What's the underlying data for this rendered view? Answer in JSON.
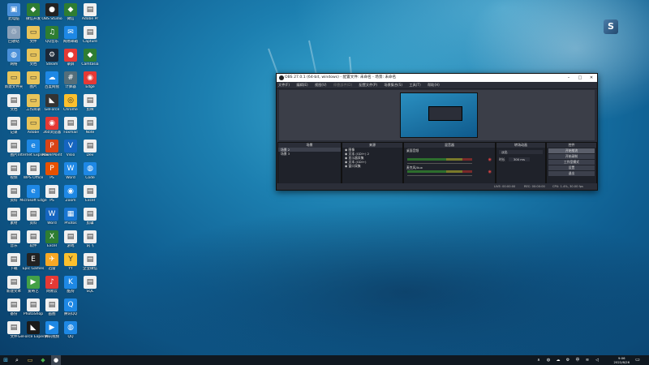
{
  "desktop": {
    "icons": [
      {
        "label": "此电脑",
        "color": "#4a90d9",
        "glyph": "▣"
      },
      {
        "label": "回收站",
        "color": "#8aa0b8",
        "glyph": "♲"
      },
      {
        "label": "网络",
        "color": "#4a90d9",
        "glyph": "◍"
      },
      {
        "label": "新建文件夹",
        "color": "#e8c45a",
        "glyph": "▭"
      },
      {
        "label": "文档",
        "color": "#f0f0f0",
        "glyph": "▤"
      },
      {
        "label": "记录",
        "color": "#f0f0f0",
        "glyph": "▤"
      },
      {
        "label": "图片",
        "color": "#f0f0f0",
        "glyph": "▤"
      },
      {
        "label": "视频",
        "color": "#f0f0f0",
        "glyph": "▤"
      },
      {
        "label": "资料",
        "color": "#f0f0f0",
        "glyph": "▤"
      },
      {
        "label": "素材",
        "color": "#f0f0f0",
        "glyph": "▤"
      },
      {
        "label": "音乐",
        "color": "#f0f0f0",
        "glyph": "▤"
      },
      {
        "label": "下载",
        "color": "#f0f0f0",
        "glyph": "▤"
      },
      {
        "label": "新建文本",
        "color": "#f0f0f0",
        "glyph": "▤"
      },
      {
        "label": "备份",
        "color": "#f0f0f0",
        "glyph": "▤"
      },
      {
        "label": "文件",
        "color": "#f0f0f0",
        "glyph": "▤"
      },
      {
        "label": "微信开发",
        "color": "#2e7d32",
        "glyph": "◆"
      },
      {
        "label": "文件",
        "color": "#e8c45a",
        "glyph": "▭"
      },
      {
        "label": "文档",
        "color": "#e8c45a",
        "glyph": "▭"
      },
      {
        "label": "图片",
        "color": "#e8c45a",
        "glyph": "▭"
      },
      {
        "label": "工作目录",
        "color": "#e8c45a",
        "glyph": "▭"
      },
      {
        "label": "Adobe",
        "color": "#e8c45a",
        "glyph": "▭"
      },
      {
        "label": "Internet Explorer",
        "color": "#1e88e5",
        "glyph": "e"
      },
      {
        "label": "WPS Office",
        "color": "#f0f0f0",
        "glyph": "▤"
      },
      {
        "label": "Microsoft Edge",
        "color": "#1e88e5",
        "glyph": "e"
      },
      {
        "label": "资料",
        "color": "#f0f0f0",
        "glyph": "▤"
      },
      {
        "label": "软件",
        "color": "#f0f0f0",
        "glyph": "▤"
      },
      {
        "label": "Epic Games",
        "color": "#222",
        "glyph": "E"
      },
      {
        "label": "爱奇艺",
        "color": "#43a047",
        "glyph": "▶"
      },
      {
        "label": "PhotoShop",
        "color": "#f0f0f0",
        "glyph": "▤"
      },
      {
        "label": "GeForce Experience",
        "color": "#1a1a1a",
        "glyph": "◣"
      },
      {
        "label": "OBS Studio",
        "color": "#222",
        "glyph": "●"
      },
      {
        "label": "QQ音乐",
        "color": "#2e7d32",
        "glyph": "♫"
      },
      {
        "label": "Steam",
        "color": "#1b2838",
        "glyph": "⚙"
      },
      {
        "label": "百度网盘",
        "color": "#1e88e5",
        "glyph": "☁"
      },
      {
        "label": "GeForce",
        "color": "#333",
        "glyph": "◣"
      },
      {
        "label": "360浏览器",
        "color": "#e53935",
        "glyph": "◉"
      },
      {
        "label": "PowerPoint",
        "color": "#d84315",
        "glyph": "P"
      },
      {
        "label": "PS",
        "color": "#e65100",
        "glyph": "P"
      },
      {
        "label": "PS",
        "color": "#f0f0f0",
        "glyph": "▤"
      },
      {
        "label": "Word",
        "color": "#1565c0",
        "glyph": "W"
      },
      {
        "label": "Excel",
        "color": "#2e7d32",
        "glyph": "X"
      },
      {
        "label": "迅雷",
        "color": "#f9a825",
        "glyph": "✈"
      },
      {
        "label": "网易云",
        "color": "#e53935",
        "glyph": "♪"
      },
      {
        "label": "画图",
        "color": "#f0f0f0",
        "glyph": "▤"
      },
      {
        "label": "腾讯视频",
        "color": "#1e88e5",
        "glyph": "▶"
      },
      {
        "label": "微信",
        "color": "#2e7d32",
        "glyph": "◆"
      },
      {
        "label": "网易邮箱",
        "color": "#1e88e5",
        "glyph": "✉"
      },
      {
        "label": "录屏",
        "color": "#e53935",
        "glyph": "●"
      },
      {
        "label": "计算器",
        "color": "#546e7a",
        "glyph": "#"
      },
      {
        "label": "Chrome",
        "color": "#fbc02d",
        "glyph": "◎"
      },
      {
        "label": "Foxmail",
        "color": "#f0f0f0",
        "glyph": "▤"
      },
      {
        "label": "Visio",
        "color": "#1565c0",
        "glyph": "V"
      },
      {
        "label": "Word",
        "color": "#1e88e5",
        "glyph": "W"
      },
      {
        "label": "Zoom",
        "color": "#1e88e5",
        "glyph": "◉"
      },
      {
        "label": "Photos",
        "color": "#1976d2",
        "glyph": "▦"
      },
      {
        "label": "游戏",
        "color": "#f0f0f0",
        "glyph": "▤"
      },
      {
        "label": "YY",
        "color": "#fbc02d",
        "glyph": "Y"
      },
      {
        "label": "酷狗",
        "color": "#1e88e5",
        "glyph": "K"
      },
      {
        "label": "腾讯QQ",
        "color": "#1e88e5",
        "glyph": "Q"
      },
      {
        "label": "QQ",
        "color": "#1e88e5",
        "glyph": "◍"
      },
      {
        "label": "Adobe Pr",
        "color": "#f0f0f0",
        "glyph": "▤"
      },
      {
        "label": "Capture",
        "color": "#f0f0f0",
        "glyph": "▤"
      },
      {
        "label": "Camtasia",
        "color": "#2e7d32",
        "glyph": "◆"
      },
      {
        "label": "Edge",
        "color": "#e53935",
        "glyph": "◉"
      },
      {
        "label": "剪映",
        "color": "#f0f0f0",
        "glyph": "▤"
      },
      {
        "label": "Note",
        "color": "#f0f0f0",
        "glyph": "▤"
      },
      {
        "label": "Dev",
        "color": "#f0f0f0",
        "glyph": "▤"
      },
      {
        "label": "Code",
        "color": "#1e88e5",
        "glyph": "◍"
      },
      {
        "label": "Excel",
        "color": "#f0f0f0",
        "glyph": "▤"
      },
      {
        "label": "剪辑",
        "color": "#f0f0f0",
        "glyph": "▤"
      },
      {
        "label": "讯飞",
        "color": "#f0f0f0",
        "glyph": "▤"
      },
      {
        "label": "企业微信",
        "color": "#f0f0f0",
        "glyph": "▤"
      },
      {
        "label": "SQL",
        "color": "#f0f0f0",
        "glyph": "▤"
      }
    ]
  },
  "obs": {
    "title": "OBS 27.0.1 (64-bit, windows) - 配置文件: 未命名 - 场景: 未命名",
    "menu": [
      "文件(F)",
      "编辑(E)",
      "视图(V)",
      "停靠部件(D)",
      "配置文件(P)",
      "场景集合(S)",
      "工具(T)",
      "帮助(H)"
    ],
    "docks": {
      "scenes": {
        "title": "场景",
        "items": [
          "场景 2",
          "场景 3"
        ]
      },
      "sources": {
        "title": "来源",
        "items": [
          "图像",
          "文本 (GDI+) 2",
          "显示器采集",
          "文本 (GDI+)",
          "窗口采集"
        ]
      },
      "mixer": {
        "title": "混音器",
        "tracks": [
          {
            "name": "桌面音频",
            "level": "0.0 dB"
          },
          {
            "name": "麦克风/Aux",
            "level": "0.0 dB"
          }
        ]
      },
      "transitions": {
        "title": "转场动画",
        "type": "淡出",
        "duration_label": "时长",
        "duration": "300 ms"
      },
      "controls": {
        "title": "控件",
        "buttons": [
          "开始推流",
          "开始录制",
          "工作室模式",
          "设置",
          "退出"
        ]
      }
    },
    "status": {
      "live": "LIVE: 00:00:00",
      "rec": "REC: 00:00:00",
      "cpu": "CPU: 1.4%, 30.00 fps"
    }
  },
  "taskbar": {
    "time": "9:06",
    "date": "2022/6/26"
  }
}
